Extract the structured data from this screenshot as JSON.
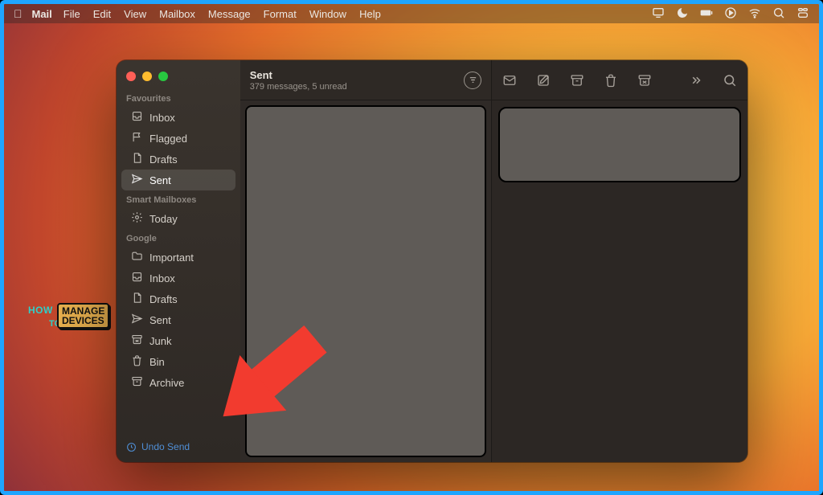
{
  "menubar": {
    "appName": "Mail",
    "items": [
      "File",
      "Edit",
      "View",
      "Mailbox",
      "Message",
      "Format",
      "Window",
      "Help"
    ]
  },
  "watermark": {
    "line1": "HOW",
    "line2": "TO",
    "box1": "MANAGE",
    "box2": "DEVICES"
  },
  "sidebar": {
    "favHeader": "Favourites",
    "fav": [
      {
        "icon": "inbox",
        "label": "Inbox"
      },
      {
        "icon": "flag",
        "label": "Flagged"
      },
      {
        "icon": "doc",
        "label": "Drafts"
      },
      {
        "icon": "send",
        "label": "Sent",
        "selected": true
      }
    ],
    "smartHeader": "Smart Mailboxes",
    "smart": [
      {
        "icon": "gear",
        "label": "Today"
      }
    ],
    "googleHeader": "Google",
    "google": [
      {
        "icon": "folder",
        "label": "Important"
      },
      {
        "icon": "inbox",
        "label": "Inbox"
      },
      {
        "icon": "doc",
        "label": "Drafts"
      },
      {
        "icon": "send",
        "label": "Sent"
      },
      {
        "icon": "junk",
        "label": "Junk"
      },
      {
        "icon": "trash",
        "label": "Bin"
      },
      {
        "icon": "archive",
        "label": "Archive"
      }
    ],
    "undoSend": "Undo Send"
  },
  "listPane": {
    "title": "Sent",
    "subtitle": "379 messages, 5 unread"
  }
}
